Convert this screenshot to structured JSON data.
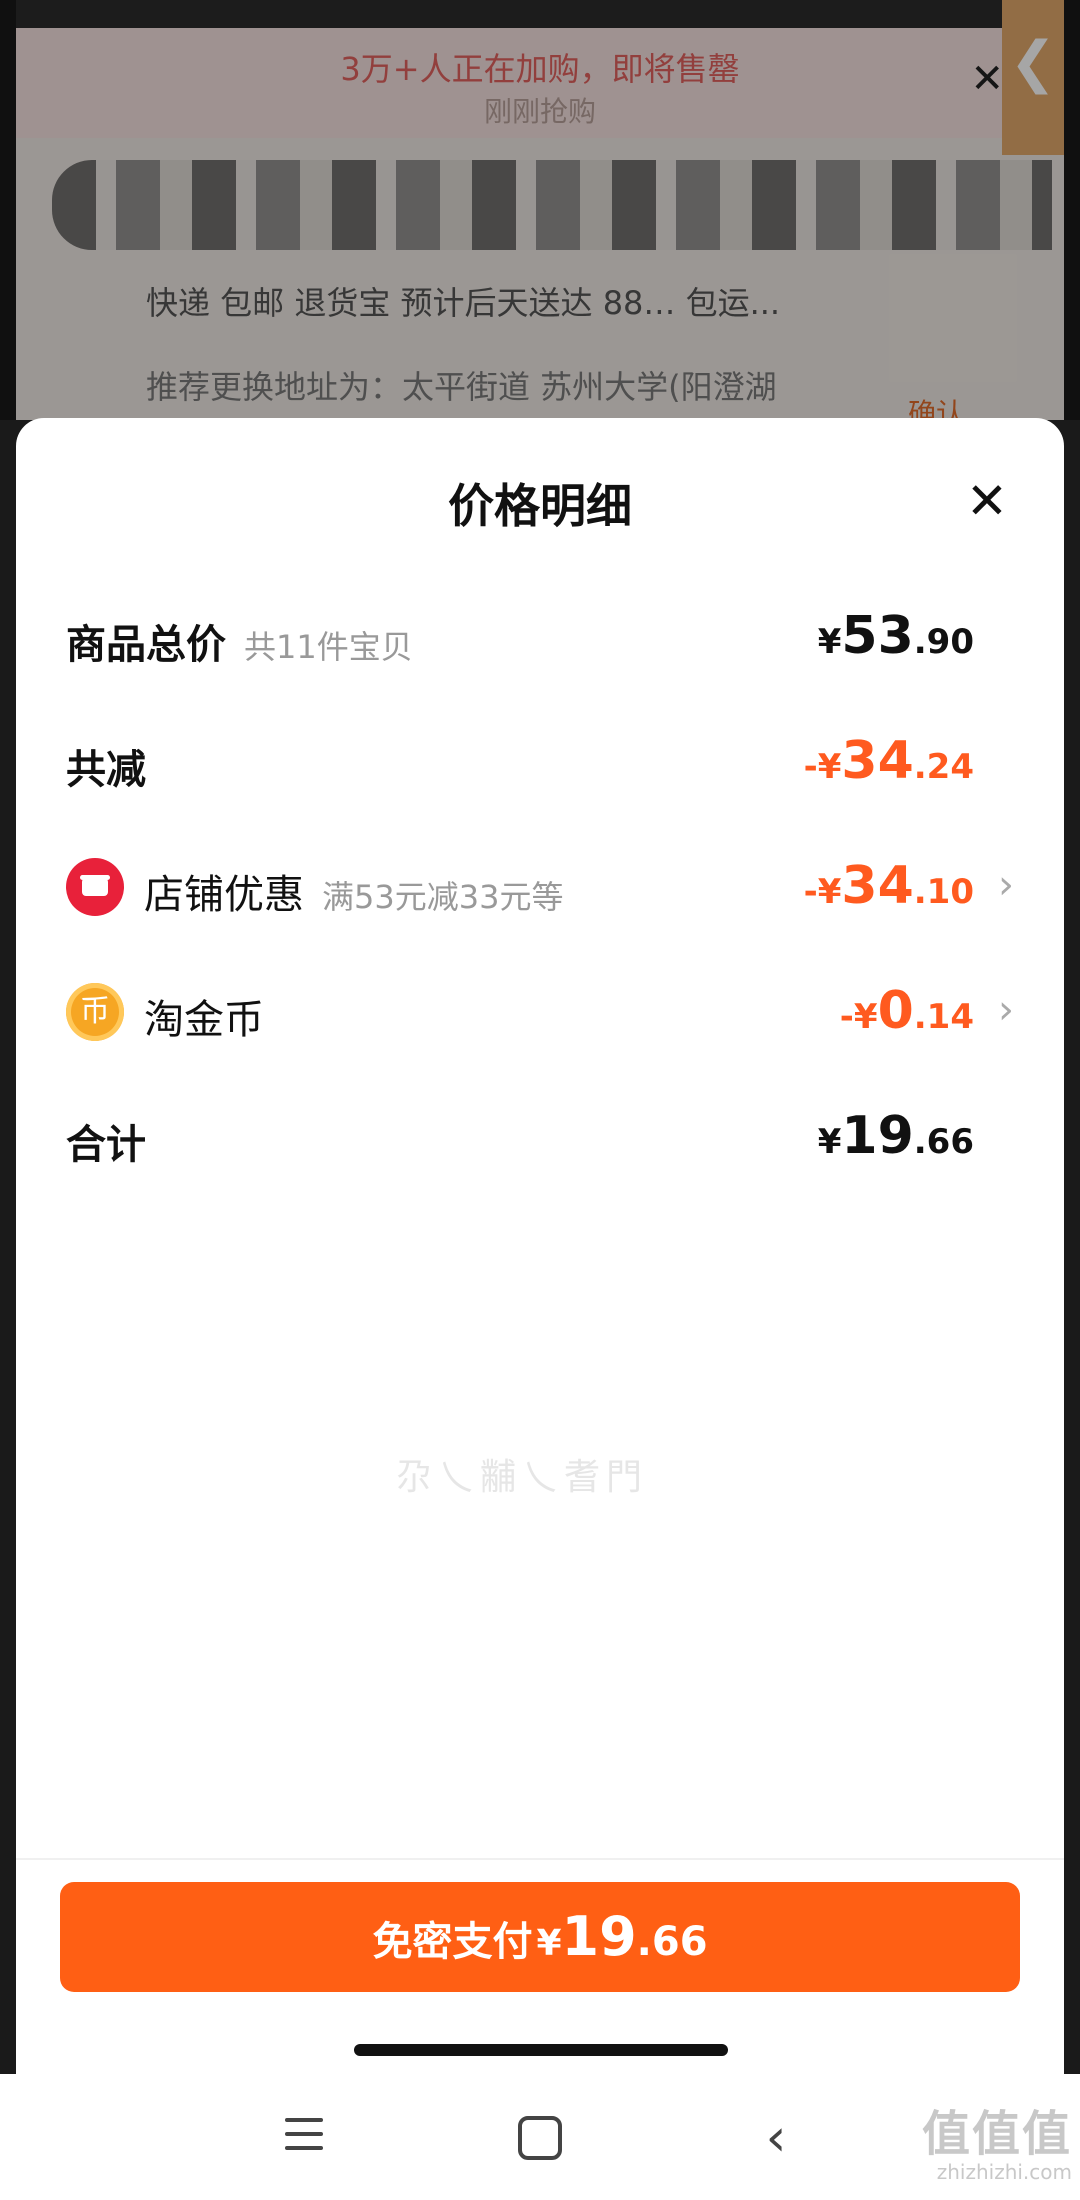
{
  "background": {
    "banner_text": "3万+人正在加购，即将售罄",
    "banner_subtext": "刚刚抢购",
    "delivery_line": "快递 包邮 退货宝 预计后天送达 88…  包运...",
    "address_line": "推荐更换地址为：太平街道 苏州大学(阳澄湖",
    "confirm_label": "确认"
  },
  "sheet": {
    "title": "价格明细",
    "close_icon": "close-icon",
    "rows": {
      "total": {
        "label": "商品总价",
        "sub": "共11件宝贝",
        "currency": "¥",
        "int": "53",
        "dec": ".90"
      },
      "discount": {
        "label": "共减",
        "currency": "-¥",
        "int": "34",
        "dec": ".24"
      },
      "shop": {
        "label": "店铺优惠",
        "sub": "满53元减33元等",
        "currency": "-¥",
        "int": "34",
        "dec": ".10",
        "icon": "shop-icon"
      },
      "coin": {
        "label": "淘金币",
        "currency": "-¥",
        "int": "0",
        "dec": ".14",
        "icon": "coin-icon",
        "icon_glyph": "币"
      },
      "sum": {
        "label": "合计",
        "currency": "¥",
        "int": "19",
        "dec": ".66"
      }
    },
    "watermark": "尕乀黼乀耆門",
    "pay_button": {
      "label": "免密支付",
      "currency": "¥",
      "int": "19",
      "dec": ".66"
    }
  },
  "system_nav": {
    "logo": "值值值",
    "logo_url": "zhizhizhi.com"
  },
  "colors": {
    "accent": "#ff5f14",
    "discount": "#ff5a1f",
    "shop_icon": "#e8213a",
    "coin_icon": "#f6a623"
  }
}
